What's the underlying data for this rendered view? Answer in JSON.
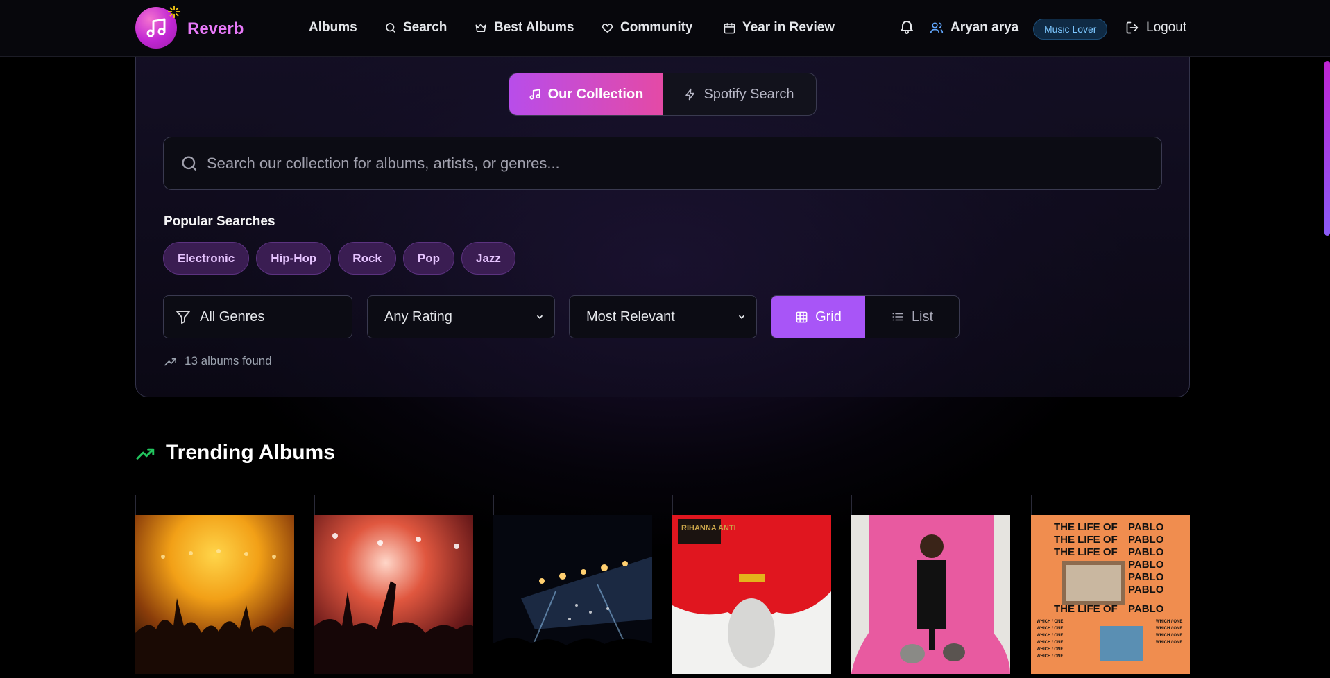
{
  "nav": {
    "brand": "Reverb",
    "links": [
      {
        "label": "Albums",
        "icon": "none"
      },
      {
        "label": "Search",
        "icon": "search-icon"
      },
      {
        "label": "Best Albums",
        "icon": "crown-icon"
      },
      {
        "label": "Community",
        "icon": "heart-icon"
      },
      {
        "label": "Year in Review",
        "icon": "calendar-icon"
      }
    ],
    "user_name": "Aryan arya",
    "user_badge": "Music Lover",
    "logout_label": "Logout"
  },
  "search": {
    "tabs": [
      {
        "label": "Our Collection",
        "active": true
      },
      {
        "label": "Spotify Search",
        "active": false
      }
    ],
    "placeholder": "Search our collection for albums, artists, or genres...",
    "popular_title": "Popular Searches",
    "popular": [
      "Electronic",
      "Hip-Hop",
      "Rock",
      "Pop",
      "Jazz"
    ],
    "filters": {
      "genre": "All Genres",
      "rating": "Any Rating",
      "sort": "Most Relevant"
    },
    "view": {
      "grid_label": "Grid",
      "list_label": "List",
      "active": "grid"
    },
    "results_count": "13 albums found"
  },
  "trending": {
    "title": "Trending Albums",
    "albums": [
      {
        "art": "concert-crowd-golden"
      },
      {
        "art": "concert-crowd-red"
      },
      {
        "art": "festival-stage-lights"
      },
      {
        "art": "anti-album-cover",
        "cover_text": "RIHANNA ANTI"
      },
      {
        "art": "man-with-dogs-pink-backdrop"
      },
      {
        "art": "the-life-of-pablo-cover",
        "cover_title": "THE LIFE OF",
        "cover_word": "PABLO",
        "cover_small": "WHICH / ONE"
      }
    ]
  },
  "colors": {
    "accent": "#a855f7",
    "brand": "#e879f9",
    "gradient_start": "#b84dea",
    "gradient_end": "#e44aa6",
    "badge": "#7cc7ff"
  }
}
